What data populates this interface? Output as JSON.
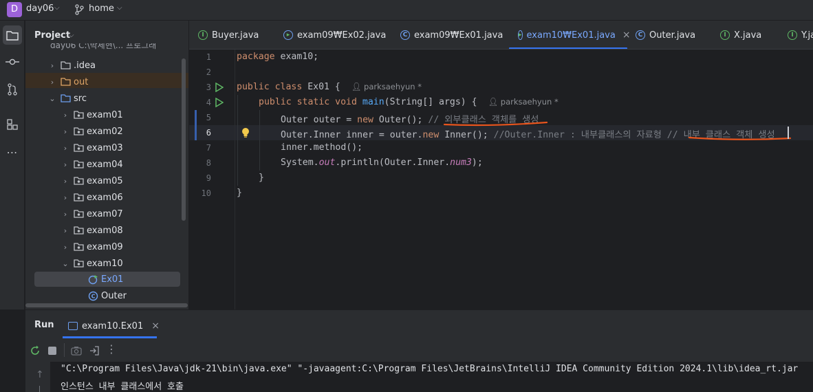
{
  "titlebar": {
    "project_badge": "D",
    "project_name": "day06",
    "branch": "home"
  },
  "project_panel": {
    "title": "Project",
    "root_partial": "day06  C:\\박세현\\... 프로그래",
    "items": [
      {
        "label": ".idea"
      },
      {
        "label": "out"
      },
      {
        "label": "src"
      },
      {
        "label": "exam01"
      },
      {
        "label": "exam02"
      },
      {
        "label": "exam03"
      },
      {
        "label": "exam04"
      },
      {
        "label": "exam05"
      },
      {
        "label": "exam06"
      },
      {
        "label": "exam07"
      },
      {
        "label": "exam08"
      },
      {
        "label": "exam09"
      },
      {
        "label": "exam10"
      },
      {
        "label": "Ex01"
      },
      {
        "label": "Outer"
      }
    ]
  },
  "tabs": [
    {
      "label": "Buyer.java",
      "icon": "interface-icon"
    },
    {
      "label": "exam09₩Ex02.java",
      "icon": "run-class-icon"
    },
    {
      "label": "exam09₩Ex01.java",
      "icon": "class-icon"
    },
    {
      "label": "exam10₩Ex01.java",
      "icon": "run-class-icon",
      "close": "×"
    },
    {
      "label": "Outer.java",
      "icon": "class-icon"
    },
    {
      "label": "X.java",
      "icon": "interface-icon"
    },
    {
      "label": "Y.ja",
      "icon": "interface-icon"
    }
  ],
  "editor": {
    "line_numbers": [
      "1",
      "2",
      "3",
      "4",
      "5",
      "6",
      "7",
      "8",
      "9",
      "10"
    ],
    "lines": {
      "l1_kw": "package",
      "l1_rest": " exam10;",
      "l3_kw": "public class",
      "l3_rest": " Ex01 {  ",
      "l3_hint": "parksaehyun *",
      "l4_kw": "public static void",
      "l4_fn": "main",
      "l4_rest": "(String[] args) {  ",
      "l4_hint": "parksaehyun *",
      "l5_a": "Outer outer = ",
      "l5_kw": "new",
      "l5_b": " Outer(); ",
      "l5_cm": "// 외부클래스 객체를 생성",
      "l6_a": "Outer.Inner inner = outer.",
      "l6_kw": "new",
      "l6_b": " Inner(); ",
      "l6_cm": "//Outer.Inner : 내부클래스의 자료형 // 내부 클래스 객체 생성",
      "l7": "inner.method();",
      "l8_a": "System.",
      "l8_st": "out",
      "l8_b": ".println(Outer.Inner.",
      "l8_st2": "num3",
      "l8_c": ");",
      "l9": "}",
      "l10": "}"
    }
  },
  "run_panel": {
    "title": "Run",
    "tab_label": "exam10.Ex01",
    "tab_close": "×",
    "console_lines": [
      "\"C:\\Program Files\\Java\\jdk-21\\bin\\java.exe\" \"-javaagent:C:\\Program Files\\JetBrains\\IntelliJ IDEA Community Edition 2024.1\\lib\\idea_rt.jar",
      "인스턴스 내부 클래스에서 호출"
    ]
  },
  "colors": {
    "accent": "#3574f0",
    "annotation_underline": "#e8541c",
    "run_green": "#5fb865"
  }
}
